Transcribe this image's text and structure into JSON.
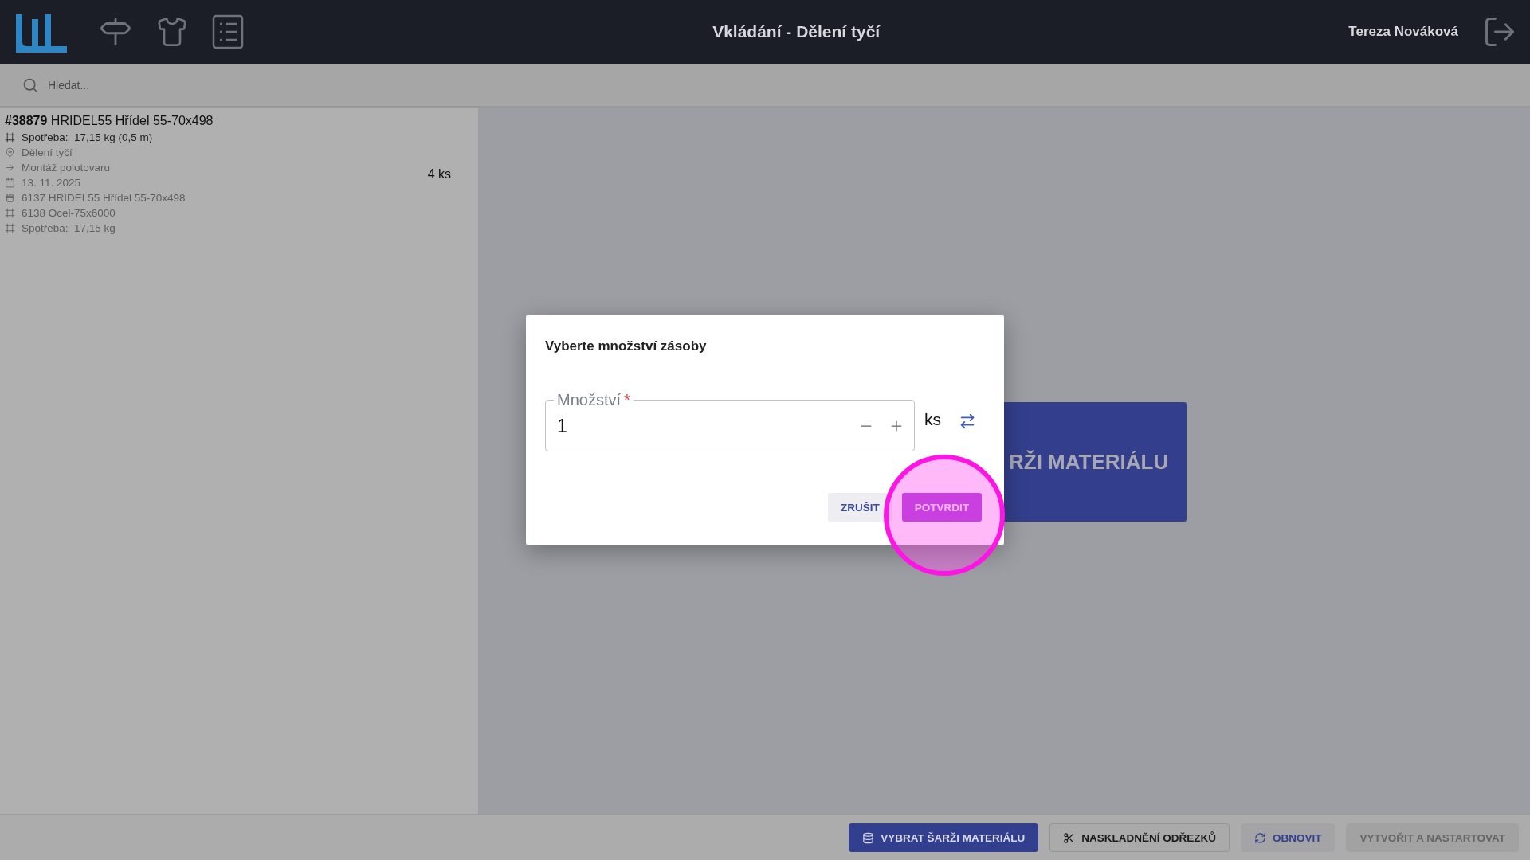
{
  "header": {
    "title": "Vkládání - Dělení tyčí",
    "user": "Tereza Nováková"
  },
  "search": {
    "placeholder": "Hledat..."
  },
  "orders": [
    {
      "number": "#38879",
      "name": "HRIDEL55 Hřídel 55-70x498",
      "quantity": "4 ks",
      "details": [
        {
          "kind": "frame",
          "text": "Spotřeba:  17,15 kg (0,5 m)",
          "highlighted": true
        },
        {
          "kind": "pin",
          "text": "Dělení tyčí",
          "highlighted": false
        },
        {
          "kind": "arrow",
          "text": "Montáž polotovaru",
          "highlighted": false
        },
        {
          "kind": "calendar",
          "text": "13. 11. 2025",
          "highlighted": false
        },
        {
          "kind": "gift",
          "text": "6137 HRIDEL55 Hřídel 55-70x498",
          "highlighted": false
        },
        {
          "kind": "frame",
          "text": "6138 Ocel-75x6000",
          "highlighted": false
        },
        {
          "kind": "frame",
          "text": "Spotřeba:  17,15 kg",
          "highlighted": false
        }
      ]
    }
  ],
  "background_button": {
    "label": "RŽI MATERIÁLU"
  },
  "dialog": {
    "title": "Vyberte množství zásoby",
    "field": {
      "label": "Množství",
      "required_mark": "*",
      "value": "1",
      "unit": "ks"
    },
    "buttons": [
      {
        "label": "ZRUŠIT",
        "kind": "text"
      },
      {
        "label": "POTVRDIT",
        "kind": "primary"
      }
    ]
  },
  "footer": [
    {
      "label": "VYBRAT ŠARŽI MATERIÁLU",
      "kind": "primary",
      "disabled": false
    },
    {
      "label": "NASKLADNĚNÍ ODŘEZKŮ",
      "kind": "outlined",
      "disabled": false
    },
    {
      "label": "OBNOVIT",
      "kind": "text",
      "disabled": false
    },
    {
      "label": "VYTVOŘIT A NASTARTOVAT",
      "kind": "filled",
      "disabled": true
    }
  ]
}
